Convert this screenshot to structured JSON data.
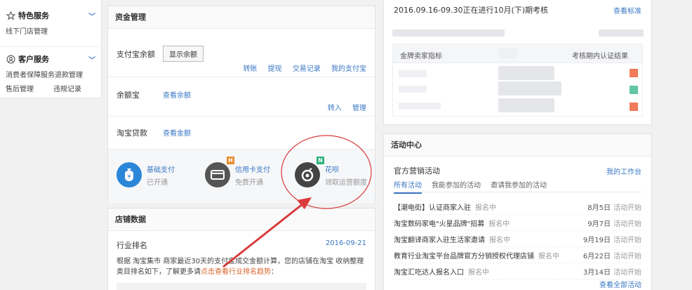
{
  "sidebar": {
    "special": {
      "title": "特色服务",
      "sub": "线下门店管理"
    },
    "customer": {
      "title": "客户服务",
      "row1": "消费者保障服务退款管理",
      "left": "售后管理",
      "right": "违规记录"
    }
  },
  "funds": {
    "title": "资金管理",
    "alipay_label": "支付宝余额",
    "show_balance": "显示余额",
    "alipay_links": [
      "转账",
      "提现",
      "交易记录",
      "我的支付宝"
    ],
    "yuebao_label": "余额宝",
    "yuebao_link": "查看余额",
    "yuebao_links": [
      "转入",
      "管理"
    ],
    "loan_label": "淘宝贷款",
    "loan_link": "查看金额",
    "pay": [
      {
        "title": "基础支付",
        "sub": "已开通",
        "tag": ""
      },
      {
        "title": "信用卡支付",
        "sub": "免费开通",
        "tag": "H"
      },
      {
        "title": "花呗",
        "sub": "领取运营额度",
        "tag": "N"
      }
    ]
  },
  "store": {
    "title": "店铺数据",
    "rank_label": "行业排名",
    "rank_date": "2016-09-21",
    "desc": "根据 淘宝集市 商家最近30天的支付宝成交金额计算，您的店铺在淘宝 收纳整理 类目排名如下，了解更多请",
    "desc_link": "点击查看行业排名趋势",
    "desc_end": "："
  },
  "assess": {
    "headline": "2016.09.16-09.30正在进行10月(下)期考核",
    "standard_link": "查看标准",
    "col1": "金牌卖家指标",
    "col2": "考核期内认证结果"
  },
  "activity": {
    "title": "活动中心",
    "official": "官方营销活动",
    "workbench": "我的工作台",
    "tabs": [
      "所有活动",
      "我能参加的活动",
      "邀请我参加的活动"
    ],
    "items": [
      {
        "title": "【潮电街】认证商家入驻",
        "status": "报名中",
        "date": "8月5日",
        "state": "活动开始"
      },
      {
        "title": "淘宝数码家电\"火星品牌\"招募",
        "status": "报名中",
        "date": "9月7日",
        "state": "活动开始"
      },
      {
        "title": "淘宝翻译商家入驻生活家邀请",
        "status": "报名中",
        "date": "9月19日",
        "state": "活动开始"
      },
      {
        "title": "教育行业淘宝平台品牌官方分销授权代理店铺",
        "status": "报名中",
        "date": "6月22日",
        "state": "活动开始"
      },
      {
        "title": "淘宝汇吃达人报名入口",
        "status": "报名中",
        "date": "3月14日",
        "state": "活动开始"
      }
    ],
    "all_link": "查看全部活动"
  },
  "colors": {
    "link": "#3a78c5",
    "annotation": "#d93a3a"
  }
}
